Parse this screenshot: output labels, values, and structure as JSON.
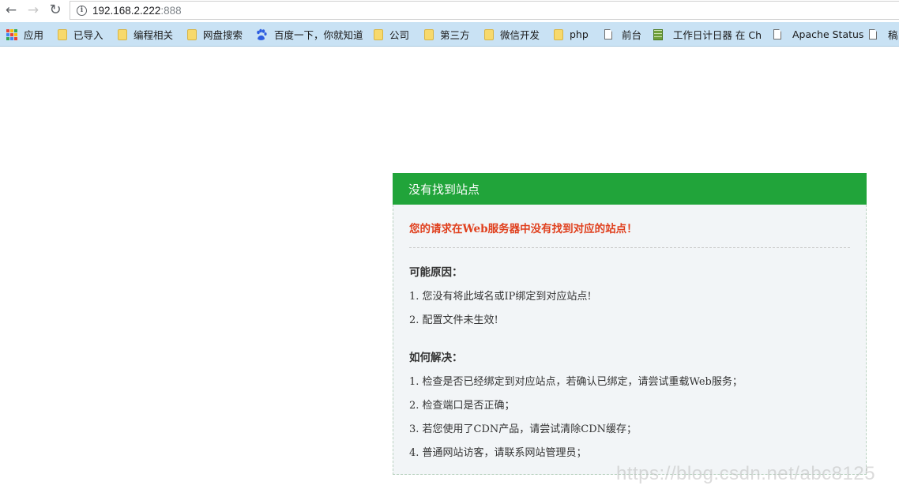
{
  "browser": {
    "url_host": "192.168.2.222",
    "url_port": ":888"
  },
  "bookmarks": [
    {
      "label": "应用",
      "icon": "apps-grid-icon"
    },
    {
      "label": "已导入",
      "icon": "folder-icon"
    },
    {
      "label": "编程相关",
      "icon": "folder-icon"
    },
    {
      "label": "网盘搜索",
      "icon": "folder-icon"
    },
    {
      "label": "百度一下，你就知道",
      "icon": "baidu-paw-icon"
    },
    {
      "label": "公司",
      "icon": "folder-icon"
    },
    {
      "label": "第三方",
      "icon": "folder-icon"
    },
    {
      "label": "微信开发",
      "icon": "folder-icon"
    },
    {
      "label": "php",
      "icon": "folder-icon"
    },
    {
      "label": "前台",
      "icon": "page-icon"
    },
    {
      "label": "工作日计日器 在 Ch",
      "icon": "calendar-icon"
    },
    {
      "label": "Apache Status",
      "icon": "page-icon"
    },
    {
      "label": "稿",
      "icon": "page-icon"
    }
  ],
  "panel": {
    "title": "没有找到站点",
    "message": "您的请求在Web服务器中没有找到对应的站点！",
    "reasons_title": "可能原因：",
    "reasons": [
      "1. 您没有将此域名或IP绑定到对应站点!",
      "2. 配置文件未生效!"
    ],
    "solutions_title": "如何解决：",
    "solutions": [
      "1. 检查是否已经绑定到对应站点，若确认已绑定，请尝试重载Web服务；",
      "2. 检查端口是否正确；",
      "3. 若您使用了CDN产品，请尝试清除CDN缓存；",
      "4. 普通网站访客，请联系网站管理员；"
    ]
  },
  "watermark": "https://blog.csdn.net/abc8125"
}
